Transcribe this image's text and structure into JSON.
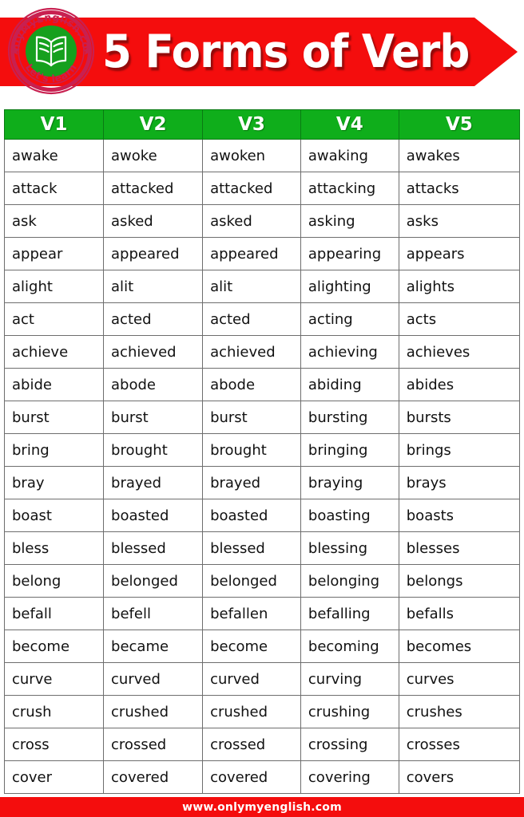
{
  "header": {
    "title": "5 Forms of Verb",
    "banner_color": "#f40d0d",
    "title_color": "#ffffff",
    "logo": {
      "top_text": "OnlyMyEnglish.com",
      "bottom_text": "Let's learn",
      "icon": "open-book-icon",
      "ring_color": "#c82050",
      "disc_color": "#16a01e"
    }
  },
  "table": {
    "header_bg": "#0fae1b",
    "header_text_color": "#ffffff",
    "columns": [
      "V1",
      "V2",
      "V3",
      "V4",
      "V5"
    ],
    "rows": [
      [
        "awake",
        "awoke",
        "awoken",
        "awaking",
        "awakes"
      ],
      [
        "attack",
        "attacked",
        "attacked",
        "attacking",
        "attacks"
      ],
      [
        "ask",
        "asked",
        "asked",
        "asking",
        "asks"
      ],
      [
        "appear",
        "appeared",
        "appeared",
        "appearing",
        "appears"
      ],
      [
        "alight",
        "alit",
        "alit",
        "alighting",
        "alights"
      ],
      [
        "act",
        "acted",
        "acted",
        "acting",
        "acts"
      ],
      [
        "achieve",
        "achieved",
        "achieved",
        "achieving",
        "achieves"
      ],
      [
        "abide",
        "abode",
        "abode",
        "abiding",
        "abides"
      ],
      [
        "burst",
        "burst",
        "burst",
        "bursting",
        "bursts"
      ],
      [
        "bring",
        "brought",
        "brought",
        "bringing",
        "brings"
      ],
      [
        "bray",
        "brayed",
        "brayed",
        "braying",
        "brays"
      ],
      [
        "boast",
        "boasted",
        "boasted",
        "boasting",
        "boasts"
      ],
      [
        "bless",
        "blessed",
        "blessed",
        "blessing",
        "blesses"
      ],
      [
        "belong",
        "belonged",
        "belonged",
        "belonging",
        "belongs"
      ],
      [
        "befall",
        "befell",
        "befallen",
        "befalling",
        "befalls"
      ],
      [
        "become",
        "became",
        "become",
        "becoming",
        "becomes"
      ],
      [
        "curve",
        "curved",
        "curved",
        "curving",
        "curves"
      ],
      [
        "crush",
        "crushed",
        "crushed",
        "crushing",
        "crushes"
      ],
      [
        "cross",
        "crossed",
        "crossed",
        "crossing",
        "crosses"
      ],
      [
        "cover",
        "covered",
        "covered",
        "covering",
        "covers"
      ]
    ]
  },
  "footer": {
    "text": "www.onlymyenglish.com",
    "bg_color": "#f40d0d",
    "text_color": "#ffffff"
  }
}
